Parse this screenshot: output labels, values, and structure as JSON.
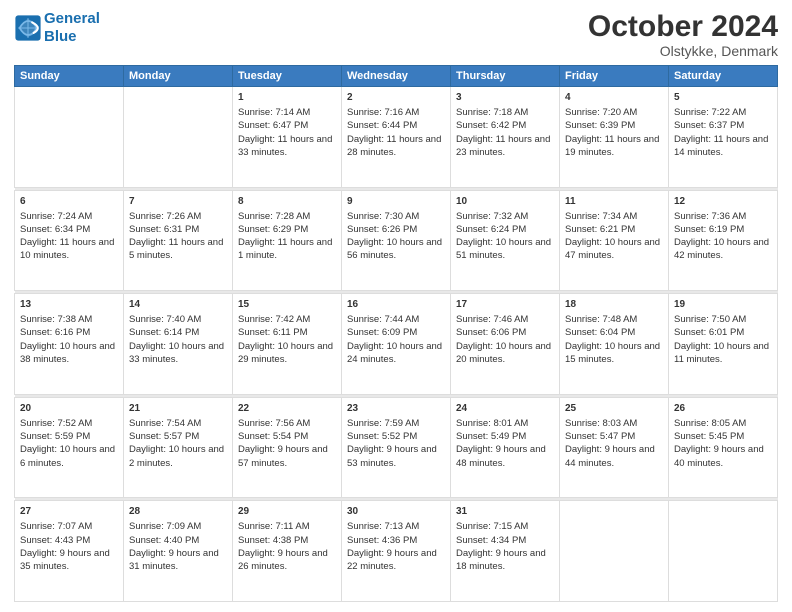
{
  "header": {
    "logo_line1": "General",
    "logo_line2": "Blue",
    "title": "October 2024",
    "subtitle": "Olstykke, Denmark"
  },
  "days_of_week": [
    "Sunday",
    "Monday",
    "Tuesday",
    "Wednesday",
    "Thursday",
    "Friday",
    "Saturday"
  ],
  "weeks": [
    {
      "days": [
        {
          "num": "",
          "sunrise": "",
          "sunset": "",
          "daylight": ""
        },
        {
          "num": "",
          "sunrise": "",
          "sunset": "",
          "daylight": ""
        },
        {
          "num": "1",
          "sunrise": "Sunrise: 7:14 AM",
          "sunset": "Sunset: 6:47 PM",
          "daylight": "Daylight: 11 hours and 33 minutes."
        },
        {
          "num": "2",
          "sunrise": "Sunrise: 7:16 AM",
          "sunset": "Sunset: 6:44 PM",
          "daylight": "Daylight: 11 hours and 28 minutes."
        },
        {
          "num": "3",
          "sunrise": "Sunrise: 7:18 AM",
          "sunset": "Sunset: 6:42 PM",
          "daylight": "Daylight: 11 hours and 23 minutes."
        },
        {
          "num": "4",
          "sunrise": "Sunrise: 7:20 AM",
          "sunset": "Sunset: 6:39 PM",
          "daylight": "Daylight: 11 hours and 19 minutes."
        },
        {
          "num": "5",
          "sunrise": "Sunrise: 7:22 AM",
          "sunset": "Sunset: 6:37 PM",
          "daylight": "Daylight: 11 hours and 14 minutes."
        }
      ]
    },
    {
      "days": [
        {
          "num": "6",
          "sunrise": "Sunrise: 7:24 AM",
          "sunset": "Sunset: 6:34 PM",
          "daylight": "Daylight: 11 hours and 10 minutes."
        },
        {
          "num": "7",
          "sunrise": "Sunrise: 7:26 AM",
          "sunset": "Sunset: 6:31 PM",
          "daylight": "Daylight: 11 hours and 5 minutes."
        },
        {
          "num": "8",
          "sunrise": "Sunrise: 7:28 AM",
          "sunset": "Sunset: 6:29 PM",
          "daylight": "Daylight: 11 hours and 1 minute."
        },
        {
          "num": "9",
          "sunrise": "Sunrise: 7:30 AM",
          "sunset": "Sunset: 6:26 PM",
          "daylight": "Daylight: 10 hours and 56 minutes."
        },
        {
          "num": "10",
          "sunrise": "Sunrise: 7:32 AM",
          "sunset": "Sunset: 6:24 PM",
          "daylight": "Daylight: 10 hours and 51 minutes."
        },
        {
          "num": "11",
          "sunrise": "Sunrise: 7:34 AM",
          "sunset": "Sunset: 6:21 PM",
          "daylight": "Daylight: 10 hours and 47 minutes."
        },
        {
          "num": "12",
          "sunrise": "Sunrise: 7:36 AM",
          "sunset": "Sunset: 6:19 PM",
          "daylight": "Daylight: 10 hours and 42 minutes."
        }
      ]
    },
    {
      "days": [
        {
          "num": "13",
          "sunrise": "Sunrise: 7:38 AM",
          "sunset": "Sunset: 6:16 PM",
          "daylight": "Daylight: 10 hours and 38 minutes."
        },
        {
          "num": "14",
          "sunrise": "Sunrise: 7:40 AM",
          "sunset": "Sunset: 6:14 PM",
          "daylight": "Daylight: 10 hours and 33 minutes."
        },
        {
          "num": "15",
          "sunrise": "Sunrise: 7:42 AM",
          "sunset": "Sunset: 6:11 PM",
          "daylight": "Daylight: 10 hours and 29 minutes."
        },
        {
          "num": "16",
          "sunrise": "Sunrise: 7:44 AM",
          "sunset": "Sunset: 6:09 PM",
          "daylight": "Daylight: 10 hours and 24 minutes."
        },
        {
          "num": "17",
          "sunrise": "Sunrise: 7:46 AM",
          "sunset": "Sunset: 6:06 PM",
          "daylight": "Daylight: 10 hours and 20 minutes."
        },
        {
          "num": "18",
          "sunrise": "Sunrise: 7:48 AM",
          "sunset": "Sunset: 6:04 PM",
          "daylight": "Daylight: 10 hours and 15 minutes."
        },
        {
          "num": "19",
          "sunrise": "Sunrise: 7:50 AM",
          "sunset": "Sunset: 6:01 PM",
          "daylight": "Daylight: 10 hours and 11 minutes."
        }
      ]
    },
    {
      "days": [
        {
          "num": "20",
          "sunrise": "Sunrise: 7:52 AM",
          "sunset": "Sunset: 5:59 PM",
          "daylight": "Daylight: 10 hours and 6 minutes."
        },
        {
          "num": "21",
          "sunrise": "Sunrise: 7:54 AM",
          "sunset": "Sunset: 5:57 PM",
          "daylight": "Daylight: 10 hours and 2 minutes."
        },
        {
          "num": "22",
          "sunrise": "Sunrise: 7:56 AM",
          "sunset": "Sunset: 5:54 PM",
          "daylight": "Daylight: 9 hours and 57 minutes."
        },
        {
          "num": "23",
          "sunrise": "Sunrise: 7:59 AM",
          "sunset": "Sunset: 5:52 PM",
          "daylight": "Daylight: 9 hours and 53 minutes."
        },
        {
          "num": "24",
          "sunrise": "Sunrise: 8:01 AM",
          "sunset": "Sunset: 5:49 PM",
          "daylight": "Daylight: 9 hours and 48 minutes."
        },
        {
          "num": "25",
          "sunrise": "Sunrise: 8:03 AM",
          "sunset": "Sunset: 5:47 PM",
          "daylight": "Daylight: 9 hours and 44 minutes."
        },
        {
          "num": "26",
          "sunrise": "Sunrise: 8:05 AM",
          "sunset": "Sunset: 5:45 PM",
          "daylight": "Daylight: 9 hours and 40 minutes."
        }
      ]
    },
    {
      "days": [
        {
          "num": "27",
          "sunrise": "Sunrise: 7:07 AM",
          "sunset": "Sunset: 4:43 PM",
          "daylight": "Daylight: 9 hours and 35 minutes."
        },
        {
          "num": "28",
          "sunrise": "Sunrise: 7:09 AM",
          "sunset": "Sunset: 4:40 PM",
          "daylight": "Daylight: 9 hours and 31 minutes."
        },
        {
          "num": "29",
          "sunrise": "Sunrise: 7:11 AM",
          "sunset": "Sunset: 4:38 PM",
          "daylight": "Daylight: 9 hours and 26 minutes."
        },
        {
          "num": "30",
          "sunrise": "Sunrise: 7:13 AM",
          "sunset": "Sunset: 4:36 PM",
          "daylight": "Daylight: 9 hours and 22 minutes."
        },
        {
          "num": "31",
          "sunrise": "Sunrise: 7:15 AM",
          "sunset": "Sunset: 4:34 PM",
          "daylight": "Daylight: 9 hours and 18 minutes."
        },
        {
          "num": "",
          "sunrise": "",
          "sunset": "",
          "daylight": ""
        },
        {
          "num": "",
          "sunrise": "",
          "sunset": "",
          "daylight": ""
        }
      ]
    }
  ]
}
